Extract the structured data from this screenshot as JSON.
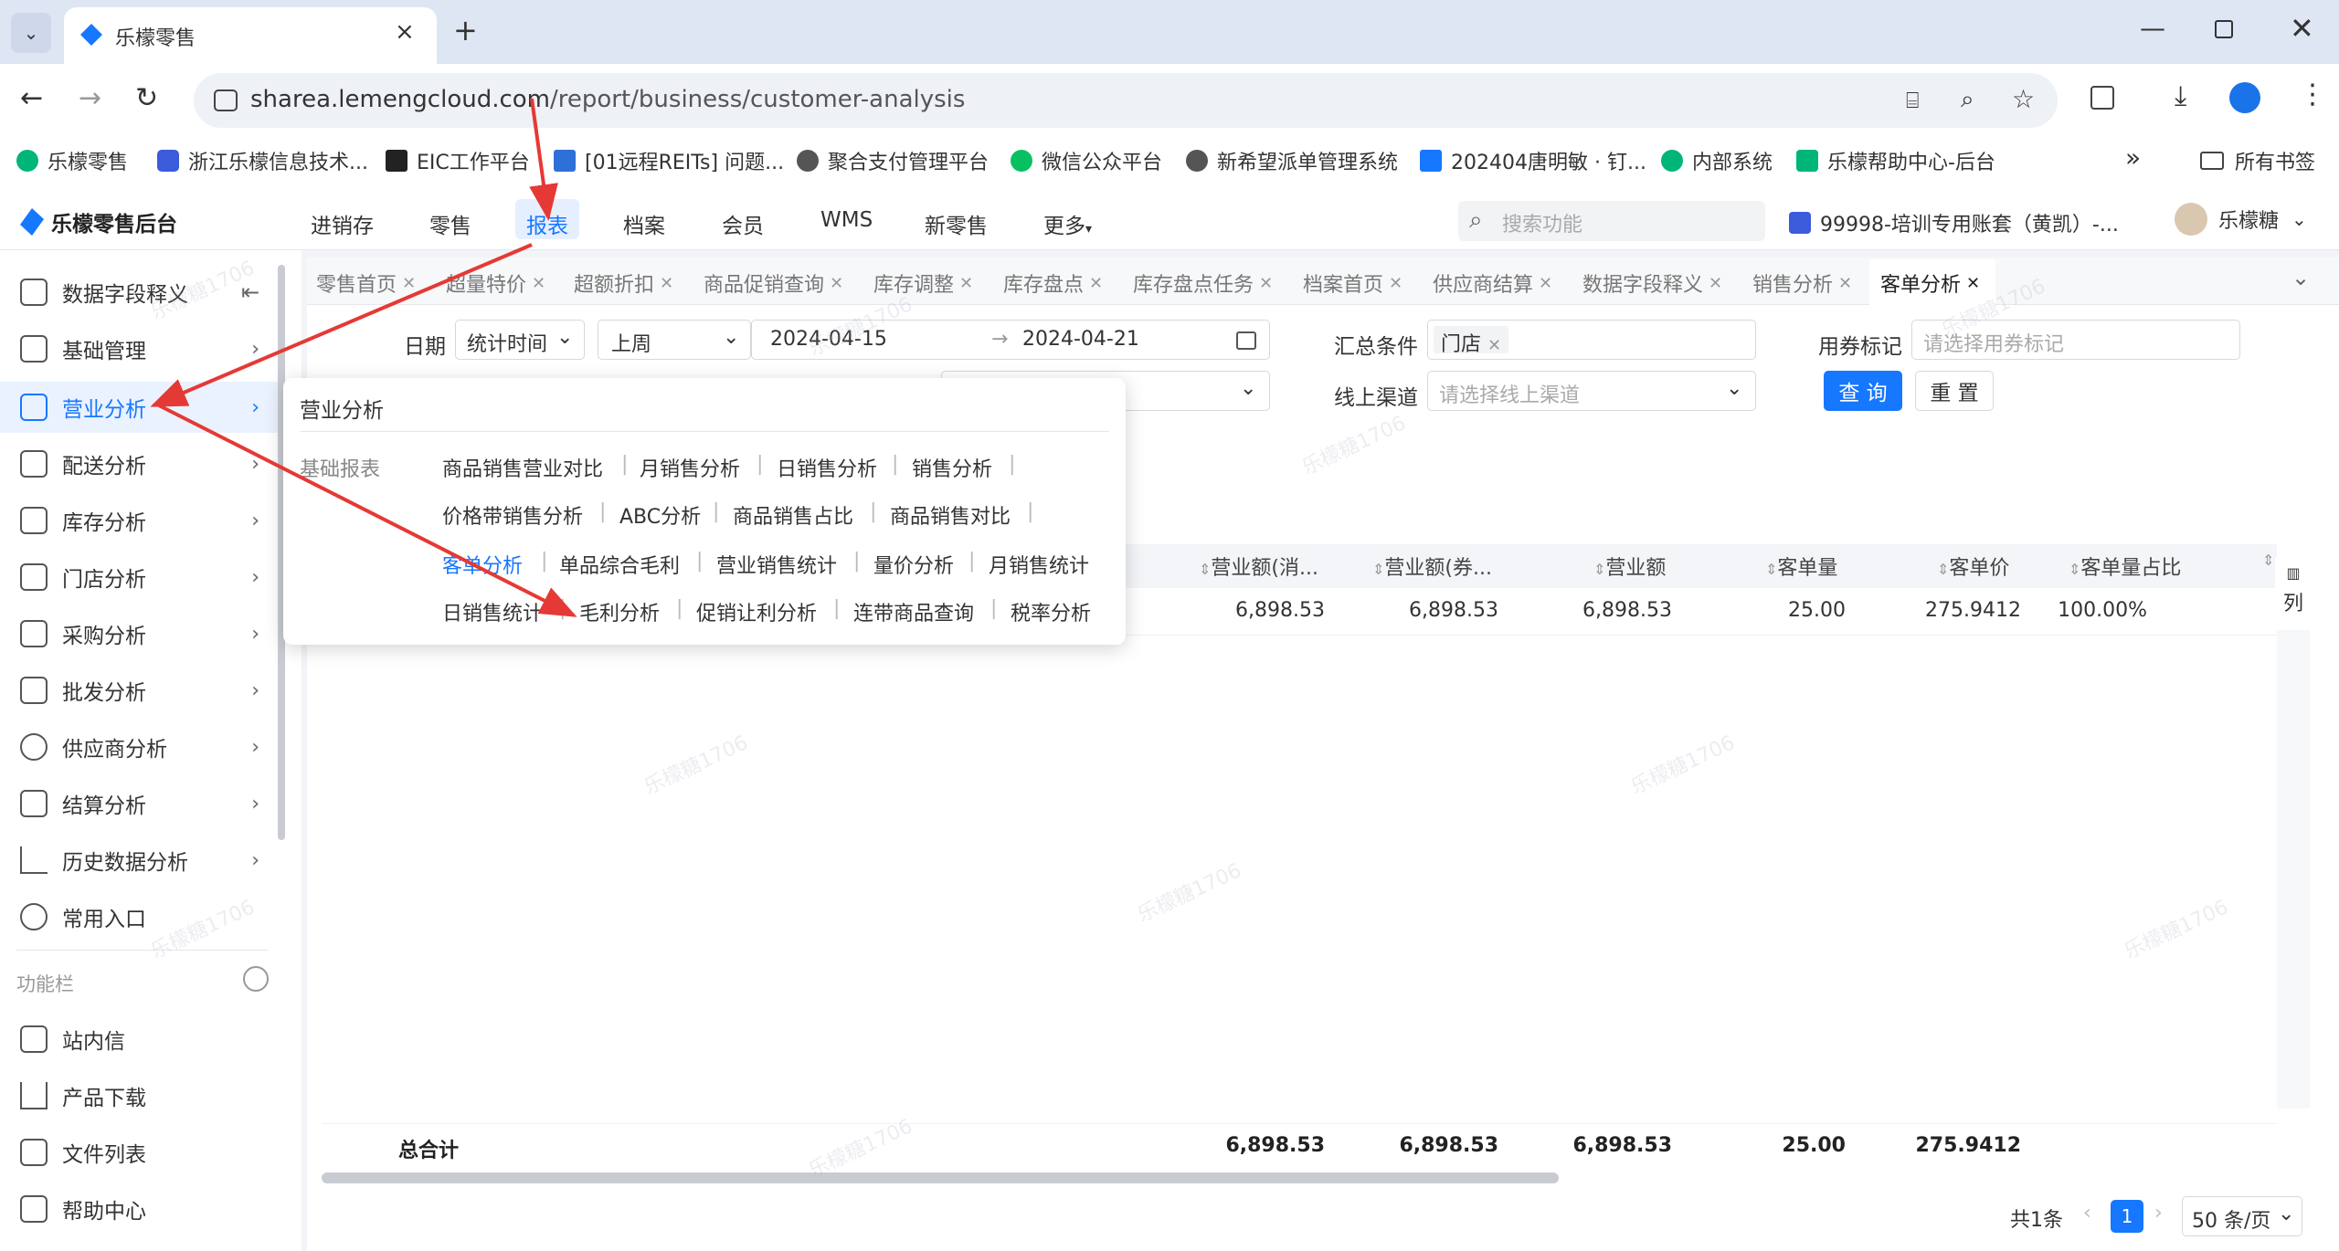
{
  "browser": {
    "tab_title": "乐檬零售",
    "url_domain": "sharea.lemengcloud.com",
    "url_path": "/report/business/customer-analysis",
    "bookmarks": [
      "乐檬零售",
      "浙江乐檬信息技术...",
      "EIC工作平台",
      "[01远程REITs] 问题...",
      "聚合支付管理平台",
      "微信公众平台",
      "新希望派单管理系统",
      "202404唐明敏 · 钉...",
      "内部系统",
      "乐檬帮助中心-后台"
    ],
    "all_bookmarks": "所有书签"
  },
  "app": {
    "logo": "乐檬零售后台",
    "nav": [
      "进销存",
      "零售",
      "报表",
      "档案",
      "会员",
      "WMS",
      "新零售",
      "更多"
    ],
    "search_placeholder": "搜索功能",
    "account": "99998-培训专用账套（黄凯）-...",
    "user": "乐檬糖"
  },
  "sidebar": {
    "items": [
      "数据字段释义",
      "基础管理",
      "营业分析",
      "配送分析",
      "库存分析",
      "门店分析",
      "采购分析",
      "批发分析",
      "供应商分析",
      "结算分析",
      "历史数据分析",
      "常用入口"
    ],
    "section": "功能栏",
    "func_items": [
      "站内信",
      "产品下载",
      "文件列表",
      "帮助中心"
    ]
  },
  "tabs": [
    "零售首页",
    "超量特价",
    "超额折扣",
    "商品促销查询",
    "库存调整",
    "库存盘点",
    "库存盘点任务",
    "档案首页",
    "供应商结算",
    "数据字段释义",
    "销售分析",
    "客单分析"
  ],
  "filters": {
    "date_label": "日期",
    "date_type": "统计时间",
    "period": "上周",
    "start": "2024-04-15",
    "end": "2024-04-21",
    "summary_label": "汇总条件",
    "summary_tag": "门店",
    "coupon_label": "用券标记",
    "coupon_placeholder": "请选择用券标记",
    "channel_label": "线上渠道",
    "channel_placeholder": "请选择线上渠道",
    "query": "查 询",
    "reset": "重 置"
  },
  "table": {
    "headers": [
      "营业额(消...",
      "营业额(券...",
      "营业额",
      "客单量",
      "客单价",
      "客单量占比"
    ],
    "row": [
      "6,898.53",
      "6,898.53",
      "6,898.53",
      "25.00",
      "275.9412",
      "100.00%"
    ],
    "total_label": "总合计",
    "totals": [
      "6,898.53",
      "6,898.53",
      "6,898.53",
      "25.00",
      "275.9412"
    ],
    "col_btn": "列"
  },
  "pagination": {
    "total": "共1条",
    "page": "1",
    "size": "50 条/页"
  },
  "popup": {
    "title": "营业分析",
    "group": "基础报表",
    "rows": [
      [
        "商品销售营业对比",
        "月销售分析",
        "日销售分析",
        "销售分析"
      ],
      [
        "价格带销售分析",
        "ABC分析",
        "商品销售占比",
        "商品销售对比"
      ],
      [
        "客单分析",
        "单品综合毛利",
        "营业销售统计",
        "量价分析",
        "月销售统计"
      ],
      [
        "日销售统计",
        "毛利分析",
        "促销让利分析",
        "连带商品查询",
        "税率分析"
      ]
    ]
  },
  "watermark": "乐檬糖1706",
  "colors": {
    "primary": "#1677ff",
    "annotation": "#e53935"
  }
}
